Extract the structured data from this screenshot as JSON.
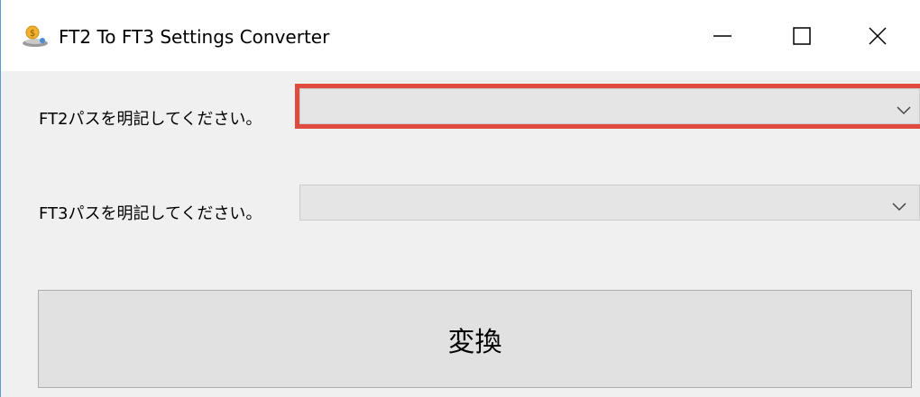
{
  "window": {
    "title": "FT2 To FT3 Settings Converter",
    "icon": "app-coin-icon",
    "controls": {
      "minimize": "minimize-icon",
      "maximize": "maximize-icon",
      "close": "close-icon"
    }
  },
  "form": {
    "ft2_label": "FT2パスを明記してください。",
    "ft2_value": "",
    "ft3_label": "FT3パスを明記してください。",
    "ft3_value": "",
    "convert_label": "変換"
  },
  "colors": {
    "highlight_border": "#e04b40",
    "window_bg": "#f0f0f0",
    "combo_bg": "#e5e5e5"
  }
}
